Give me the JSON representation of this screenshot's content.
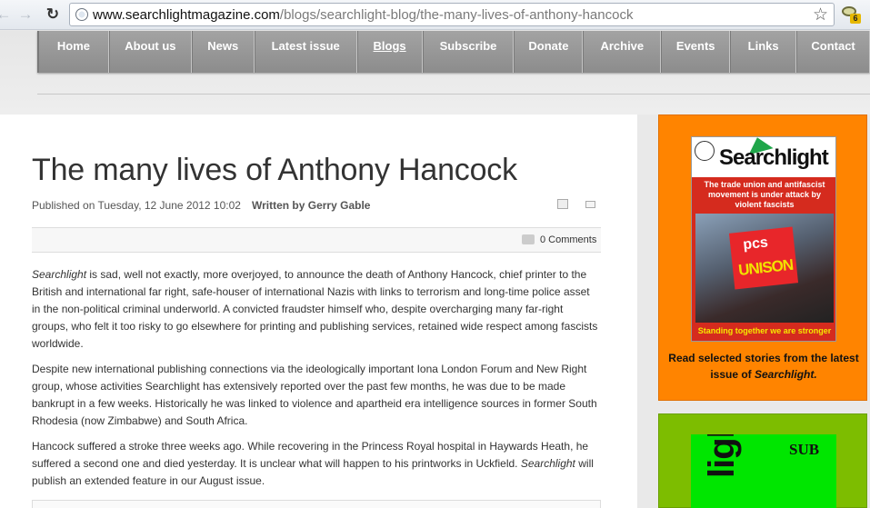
{
  "browser": {
    "url_host": "www.searchlightmagazine.com",
    "url_path": "/blogs/searchlight-blog/the-many-lives-of-anthony-hancock",
    "extension_badge": "6"
  },
  "nav": {
    "items": [
      {
        "label": "Home"
      },
      {
        "label": "About us"
      },
      {
        "label": "News"
      },
      {
        "label": "Latest issue"
      },
      {
        "label": "Blogs"
      },
      {
        "label": "Subscribe"
      },
      {
        "label": "Donate"
      },
      {
        "label": "Archive"
      },
      {
        "label": "Events"
      },
      {
        "label": "Links"
      },
      {
        "label": "Contact"
      }
    ],
    "active": "Blogs"
  },
  "article": {
    "title": "The many lives of Anthony Hancock",
    "published": "Published on Tuesday, 12 June 2012 10:02",
    "author": "Written by Gerry Gable",
    "comments": "0 Comments",
    "p1_em": "Searchlight",
    "p1_rest": " is sad, well not exactly, more overjoyed, to announce the death of Anthony Hancock, chief printer to the British and international far right, safe-houser of international Nazis with links to terrorism and long-time police asset in the non-political criminal underworld. A convicted fraudster himself who, despite overcharging many far-right groups, who felt it too risky to go elsewhere for printing and publishing services, retained wide respect among fascists worldwide.",
    "p2": "Despite new international publishing connections via the ideologically important Iona London Forum and New Right group, whose activities Searchlight has extensively reported over the past few months, he was due to be made bankrupt in a few weeks. Historically he was linked to violence and apartheid era intelligence sources in former South Rhodesia (now Zimbabwe) and South Africa.",
    "p3_a": "Hancock suffered a stroke three weeks ago. While recovering in the Princess Royal hospital in Haywards Heath, he suffered a second one and died yesterday. It is unclear what will happen to his printworks in Uckfield. ",
    "p3_em": "Searchlight",
    "p3_b": " will publish an extended feature in our August issue."
  },
  "sidebar": {
    "cover_logo": "Searchlight",
    "cover_headline": "The trade union and antifascist movement is under attack by violent fascists",
    "cover_banner_top": "pcs",
    "cover_banner_bottom": "UNISON",
    "cover_footer": "Standing together we are stronger",
    "caption_text": "Read selected stories from the latest issue of ",
    "caption_em": "Searchlight.",
    "green_word": "light",
    "green_sub": "SUB"
  },
  "colors": {
    "orange_panel": "#ff8400",
    "green_panel": "#7dbd00",
    "nav_bg": "#999999"
  }
}
